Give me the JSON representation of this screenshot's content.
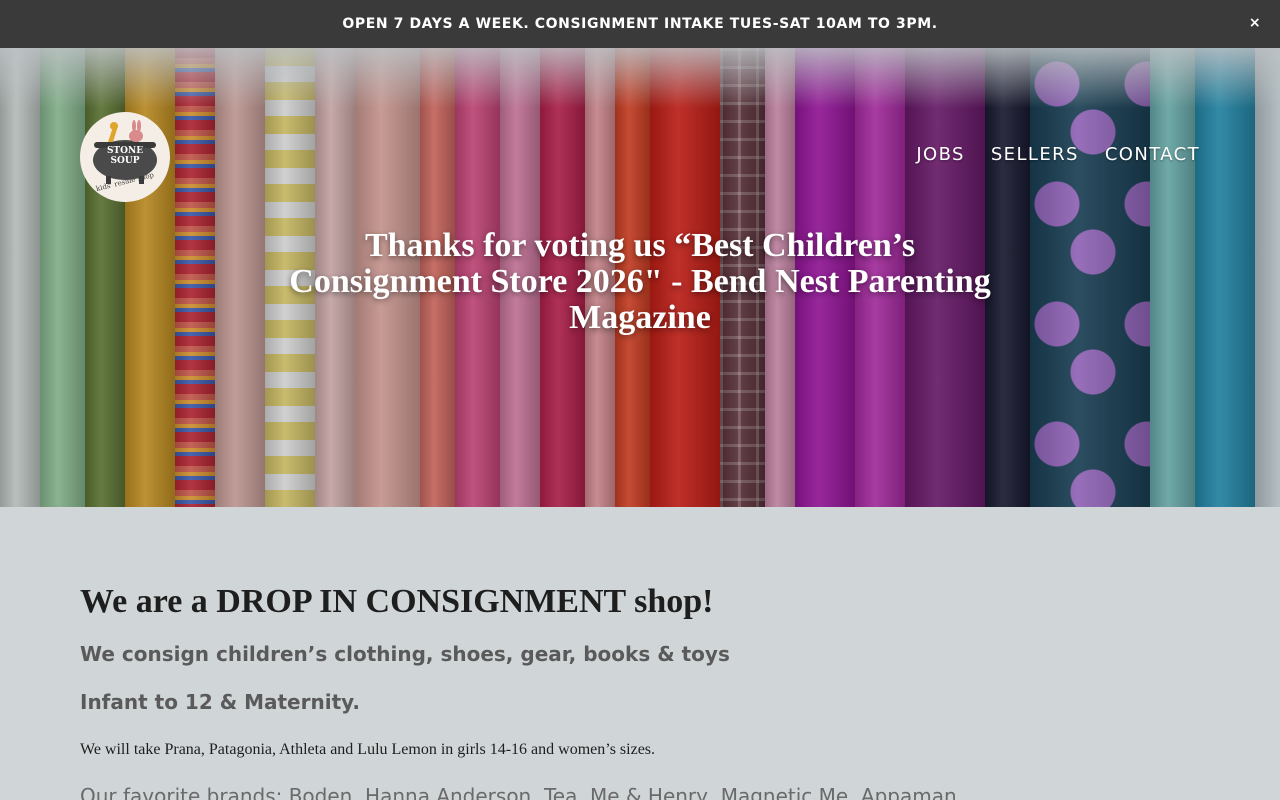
{
  "announcement": {
    "text": "OPEN 7 DAYS A WEEK. CONSIGNMENT INTAKE TUES-SAT 10AM TO 3PM.",
    "close_label": "×"
  },
  "header": {
    "logo": {
      "name_line1": "STONE",
      "name_line2": "SOUP",
      "tagline": "kids' resale shop"
    },
    "nav": [
      {
        "label": "JOBS"
      },
      {
        "label": "SELLERS"
      },
      {
        "label": "CONTACT"
      }
    ]
  },
  "hero": {
    "title": "Thanks for voting us “Best Children’s Consignment Store 2026\" - Bend Nest Parenting Magazine"
  },
  "main": {
    "heading": "We are a DROP IN CONSIGNMENT shop!",
    "subheading1": "We consign children’s clothing, shoes, gear, books & toys",
    "subheading2": "Infant to 12 & Maternity.",
    "brands_note": "We will take Prana, Patagonia, Athleta and Lulu Lemon in girls 14-16 and women’s sizes.",
    "favorites": "Our favorite brands: Boden, Hanna Anderson, Tea, Me & Henry, Magnetic Me, Appaman"
  },
  "colors": {
    "announcement_bg": "#3a3a3a",
    "page_bg": "#d0d6d8",
    "heading_text": "#1e1e1e",
    "subheading_text": "#5a5a5a"
  }
}
